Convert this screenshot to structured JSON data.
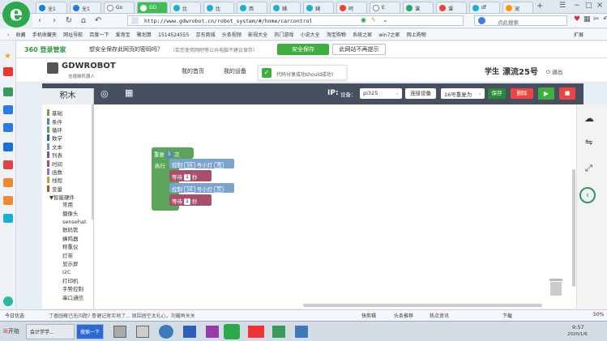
{
  "browser": {
    "tabs": [
      "全1",
      "全1",
      "Go",
      "GD",
      "比",
      "比",
      "西",
      "辅",
      "辅",
      "呵",
      "E",
      "课",
      "df",
      "宠"
    ],
    "url": "http://www.gdwrobot.cn/robot_system/#/home/carcontrol",
    "search_placeholder": "点此搜索",
    "favorites": [
      "收藏",
      "手机收藏夹",
      "网址导航",
      "百度一下",
      "爱淘宝",
      "聚划算",
      "1514524555",
      "京东商城",
      "头条视频",
      "影视大全",
      "热门游戏",
      "小说大全",
      "淘宝购物",
      "系统之家",
      "win7之家",
      "网上购物"
    ],
    "favorites_right": "扩展"
  },
  "password_bar": {
    "brand": "360 登录管家",
    "question": "想安全保存此网页的密码吗？",
    "note": "（若您使用网吧等公共电脑不建议保存）",
    "save_label": "安全保存",
    "nosave_label": "此网站不再提示"
  },
  "site": {
    "logo_title": "GDWROBOT",
    "logo_sub": "吉德维机器人",
    "nav": [
      "我的首页",
      "我的设备"
    ],
    "toast": "代码分享成功",
    "toast_id": "should成功！",
    "user_role": "学生",
    "user_name": "漂流25号",
    "logout": "退出"
  },
  "toolbar": {
    "panel_title": "积木",
    "ip_label": "IP:",
    "device_label": "设备：",
    "device_value": "pi325",
    "connect_label": "连接设备",
    "car_value": "16号重复为",
    "save_label": "保存",
    "delete_label": "删除"
  },
  "categories": [
    {
      "label": "基础",
      "color": "#7a9e3a"
    },
    {
      "label": "条件",
      "color": "#5a80c8"
    },
    {
      "label": "循环",
      "color": "#5ba55b"
    },
    {
      "label": "数学",
      "color": "#3c63a8"
    },
    {
      "label": "文本",
      "color": "#5a9bb5"
    },
    {
      "label": "列表",
      "color": "#7a4fa8"
    },
    {
      "label": "时间",
      "color": "#a84f6d"
    },
    {
      "label": "函数",
      "color": "#9a6fc0"
    },
    {
      "label": "线程",
      "color": "#b8a53a"
    },
    {
      "label": "变量",
      "color": "#a85a3a"
    }
  ],
  "hardware": {
    "label": "▼智能硬件",
    "items": [
      "常用",
      "摄像头",
      "sensehat",
      "数码管",
      "蜂鸣器",
      "称重仪",
      "灯带",
      "显示屏",
      "I2C",
      "打印机",
      "手势控制",
      "串口通信"
    ]
  },
  "blocks": {
    "repeat": "重复",
    "repeat_count": "5",
    "times": "次",
    "do": "执行",
    "control": "控制",
    "pin": "16",
    "led": "号小灯",
    "on": "亮",
    "off": "灭",
    "wait": "等待",
    "wait_val": "1",
    "sec": "秒"
  },
  "statusbar": [
    "今日优选",
    "丁香园概已无问题? 鲁健记者实地了...",
    "原因居空太礼心，刘耀再关关",
    "快剪辑",
    "头条推荐",
    "热点资讯",
    "下载",
    "50%"
  ],
  "taskbar": {
    "start": "开始",
    "items": [
      "会计学学...",
      "搜索一下"
    ],
    "time": "9:57",
    "date": "2020/1/6"
  }
}
